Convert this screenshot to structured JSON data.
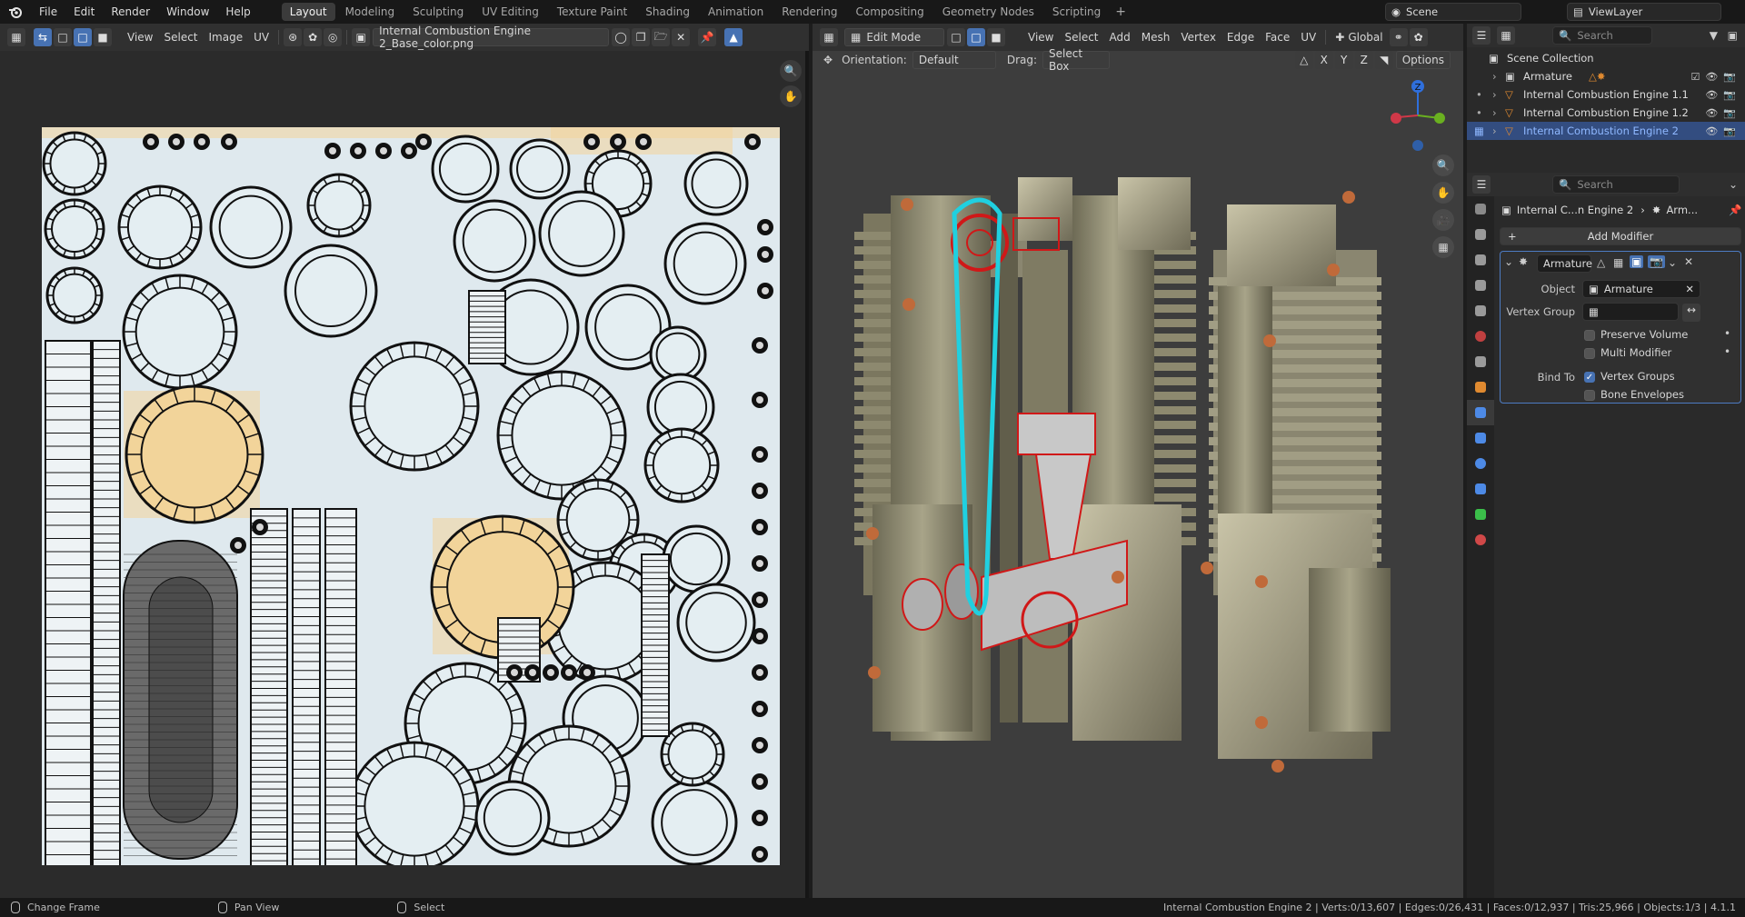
{
  "topbar": {
    "menus": [
      "File",
      "Edit",
      "Render",
      "Window",
      "Help"
    ],
    "workspaces": [
      "Layout",
      "Modeling",
      "Sculpting",
      "UV Editing",
      "Texture Paint",
      "Shading",
      "Animation",
      "Rendering",
      "Compositing",
      "Geometry Nodes",
      "Scripting"
    ],
    "active_workspace": "Layout",
    "add_label": "+",
    "scene": "Scene",
    "view_layer": "ViewLayer"
  },
  "uv_editor": {
    "menus": [
      "View",
      "Select",
      "Image",
      "UV"
    ],
    "image_name": "Internal Combustion Engine 2_Base_color.png"
  },
  "viewport": {
    "mode": "Edit Mode",
    "menus": [
      "View",
      "Select",
      "Add",
      "Mesh",
      "Vertex",
      "Edge",
      "Face",
      "UV"
    ],
    "transform": "Global",
    "orientation_label": "Orientation:",
    "orientation_value": "Default",
    "drag_label": "Drag:",
    "drag_value": "Select Box",
    "axes": [
      "X",
      "Y",
      "Z"
    ],
    "options_label": "Options",
    "gizmo_z": "Z"
  },
  "outliner": {
    "search_placeholder": "Search",
    "collection": "Scene Collection",
    "items": [
      {
        "name": "Armature"
      },
      {
        "name": "Internal Combustion Engine 1.1"
      },
      {
        "name": "Internal Combustion Engine 1.2"
      },
      {
        "name": "Internal Combustion Engine 2"
      }
    ]
  },
  "properties": {
    "search_placeholder": "Search",
    "breadcrumb_object": "Internal C...n Engine 2",
    "breadcrumb_mod": "Arm...",
    "add_modifier": "Add Modifier",
    "modifier_name": "Armature",
    "object_label": "Object",
    "object_value": "Armature",
    "vertex_group_label": "Vertex Group",
    "preserve_volume": "Preserve Volume",
    "multi_modifier": "Multi Modifier",
    "bind_to_label": "Bind To",
    "vertex_groups": "Vertex Groups",
    "bone_envelopes": "Bone Envelopes"
  },
  "statusbar": {
    "left": [
      "Change Frame",
      "Pan View",
      "Select"
    ],
    "stats": "Internal Combustion Engine 2 | Verts:0/13,607 | Edges:0/26,431 | Faces:0/12,937 | Tris:25,966 | Objects:1/3 | 4.1.1"
  },
  "colors": {
    "accent": "#4772b3",
    "selected_row": "#334d80",
    "uv_bg": "#dfe9ee",
    "viewport_bg": "#3d3d3d",
    "wire_red": "#d01818",
    "wire_cyan": "#20d0e0"
  }
}
